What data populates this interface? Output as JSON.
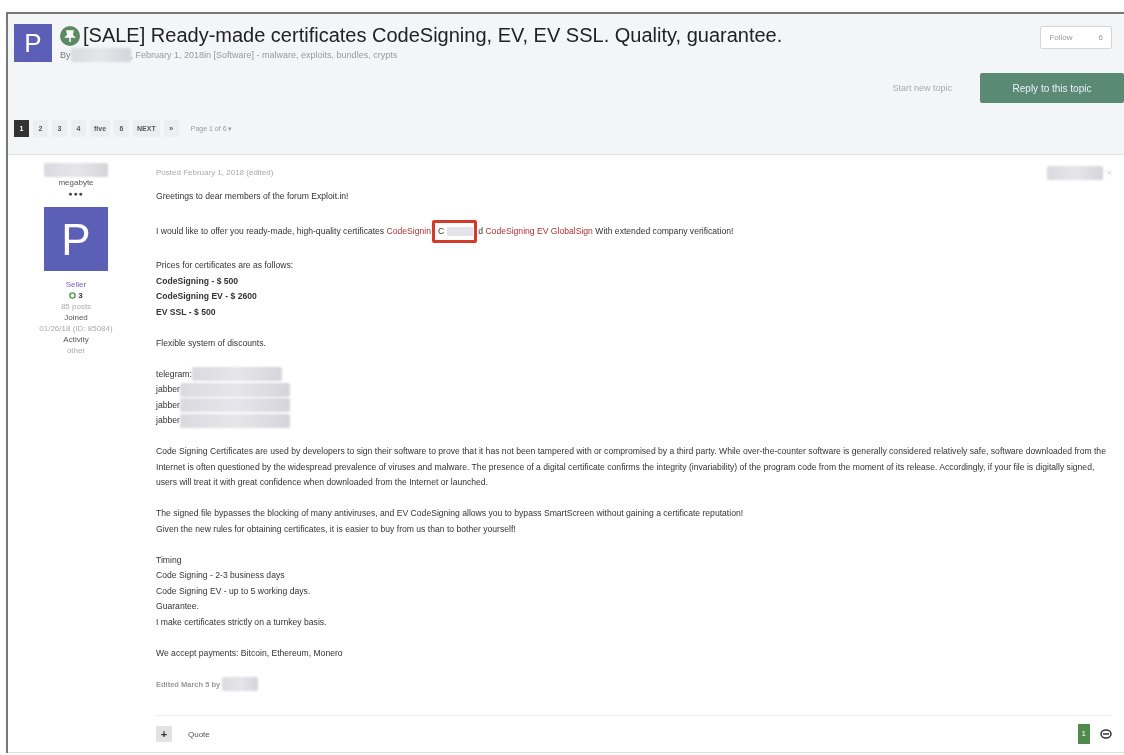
{
  "topic": {
    "avatar_letter": "P",
    "title": "[SALE] Ready-made certificates CodeSigning, EV, EV SSL. Quality, guarantee.",
    "byline_prefix": "By",
    "byline_rest": ", February 1, 2018in [Software] - malware, exploits, bundles, crypts",
    "follow_label": "Follow",
    "follow_count": "6",
    "start_topic": "Start new topic",
    "reply": "Reply to this topic"
  },
  "pagination": {
    "pages": [
      {
        "label": "1",
        "selected": true
      },
      {
        "label": "2",
        "selected": false
      },
      {
        "label": "3",
        "selected": false
      },
      {
        "label": "4",
        "selected": false
      },
      {
        "label": "five",
        "selected": false
      },
      {
        "label": "6",
        "selected": false
      }
    ],
    "next": "NEXT",
    "last": "»",
    "page_of": "Page 1 of 6 ▾"
  },
  "author": {
    "rank": "megabyte",
    "pips": "●●●",
    "avatar_letter": "P",
    "group": "Seller",
    "reputation": "3",
    "posts": "85 posts",
    "joined_label": "Joined",
    "joined": "01/26/18 (ID: 85084)",
    "activity_label": "Activity",
    "activity": "other"
  },
  "post": {
    "posted": "Posted February 1, 2018 (edited)",
    "share": "<",
    "paragraphs": [
      {
        "lines": [
          {
            "kind": "text",
            "text": "Greetings to dear members of the forum Exploit.in!"
          }
        ]
      },
      {
        "lines": [
          {
            "kind": "mixed",
            "parts": [
              {
                "kind": "plain",
                "text": "I would like to offer you ready-made, high-quality certificates "
              },
              {
                "kind": "link",
                "text": "CodeSignin"
              },
              {
                "kind": "highlight",
                "text": "C"
              },
              {
                "kind": "plain",
                "text": "d "
              },
              {
                "kind": "link",
                "text": "CodeSigning EV GlobalSign"
              },
              {
                "kind": "plain",
                "text": " With extended company verification!"
              }
            ]
          }
        ]
      },
      {
        "lines": [
          {
            "kind": "text",
            "text": "Prices for certificates are as follows:"
          },
          {
            "kind": "bold",
            "text": "CodeSigning - $ 500"
          },
          {
            "kind": "bold",
            "text": "CodeSigning EV - $ 2600"
          },
          {
            "kind": "bold",
            "text": "EV SSL - $ 500"
          }
        ]
      },
      {
        "lines": [
          {
            "kind": "text",
            "text": "Flexible system of discounts."
          }
        ]
      },
      {
        "lines": [
          {
            "kind": "contact",
            "text": "telegram:"
          },
          {
            "kind": "contact",
            "text": "jabber"
          },
          {
            "kind": "contact",
            "text": "jabber"
          },
          {
            "kind": "contact",
            "text": "jabber"
          }
        ]
      },
      {
        "lines": [
          {
            "kind": "text",
            "text": "Code Signing Certificates are used by developers to sign their software to prove that it has not been tampered with or compromised by a third party. While over-the-counter software is generally considered relatively safe, software downloaded from the Internet is often questioned by the widespread prevalence of viruses and malware. The presence of a digital certificate confirms the integrity (invariability) of the program code from the moment of its release. Accordingly, if your file is digitally signed, users will treat it with great confidence when downloaded from the Internet or launched."
          }
        ]
      },
      {
        "lines": [
          {
            "kind": "text",
            "text": "The signed file bypasses the blocking of many antiviruses, and EV CodeSigning allows you to bypass SmartScreen without gaining a certificate reputation!"
          },
          {
            "kind": "text",
            "text": "Given the new rules for obtaining certificates, it is easier to buy from us than to bother yourself!"
          }
        ]
      },
      {
        "lines": [
          {
            "kind": "text",
            "text": "Timing"
          },
          {
            "kind": "text",
            "text": "Code Signing - 2-3 business days"
          },
          {
            "kind": "text",
            "text": "Code Signing EV - up to 5 working days."
          },
          {
            "kind": "text",
            "text": "Guarantee."
          },
          {
            "kind": "text",
            "text": "I make certificates strictly on a turnkey basis."
          }
        ]
      },
      {
        "lines": [
          {
            "kind": "text",
            "text": "We accept payments: Bitcoin, Ethereum, Monero"
          }
        ]
      }
    ],
    "edited": "Edited March 5 by",
    "plus": "+",
    "quote": "Quote",
    "reactions": "1"
  }
}
